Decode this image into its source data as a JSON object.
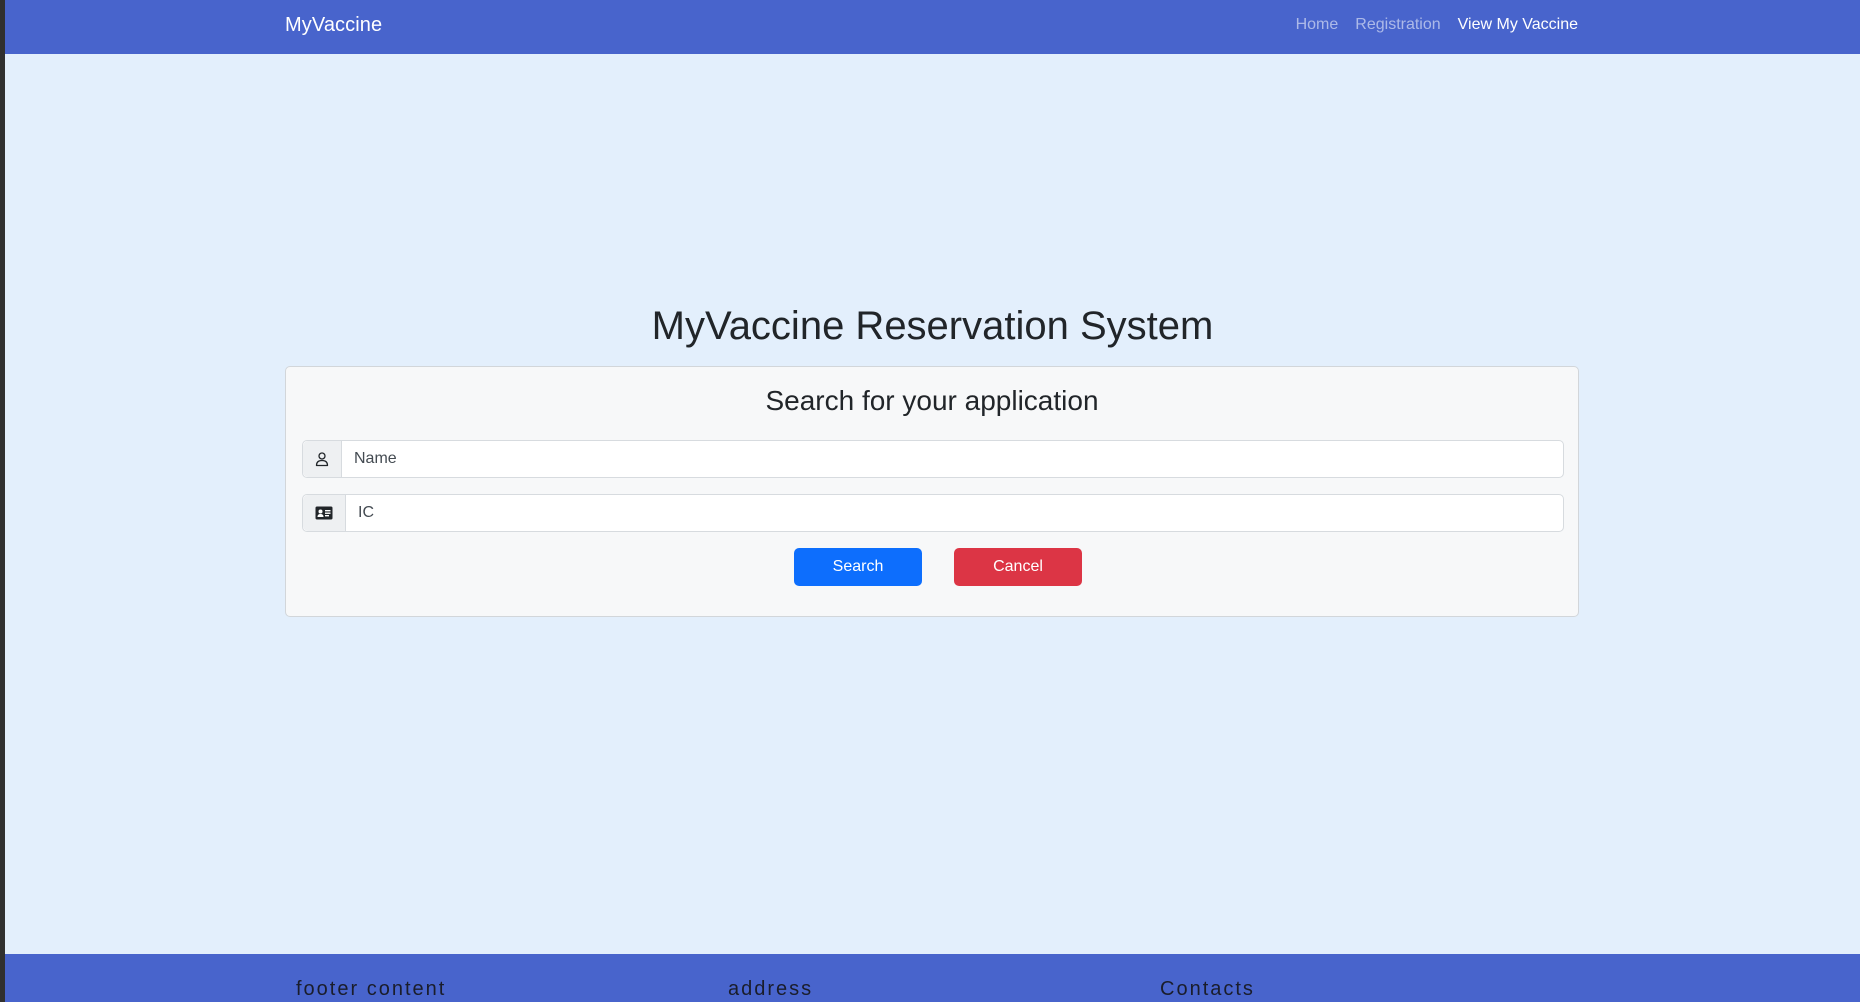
{
  "navbar": {
    "brand": "MyVaccine",
    "links": [
      {
        "label": "Home",
        "active": false
      },
      {
        "label": "Registration",
        "active": false
      },
      {
        "label": "View My Vaccine",
        "active": true
      }
    ]
  },
  "main": {
    "title": "MyVaccine Reservation System",
    "card": {
      "title": "Search for your application",
      "name_field": {
        "placeholder": "Name",
        "value": "",
        "icon": "person-icon"
      },
      "ic_field": {
        "placeholder": "IC",
        "value": "",
        "icon": "id-card-icon"
      },
      "search_label": "Search",
      "cancel_label": "Cancel"
    }
  },
  "footer": {
    "headings": [
      "footer content",
      "address",
      "Contacts"
    ]
  },
  "colors": {
    "navbar": "#4864cc",
    "page_background": "#e3effc",
    "primary_button": "#0d6efd",
    "danger_button": "#dc3545"
  }
}
